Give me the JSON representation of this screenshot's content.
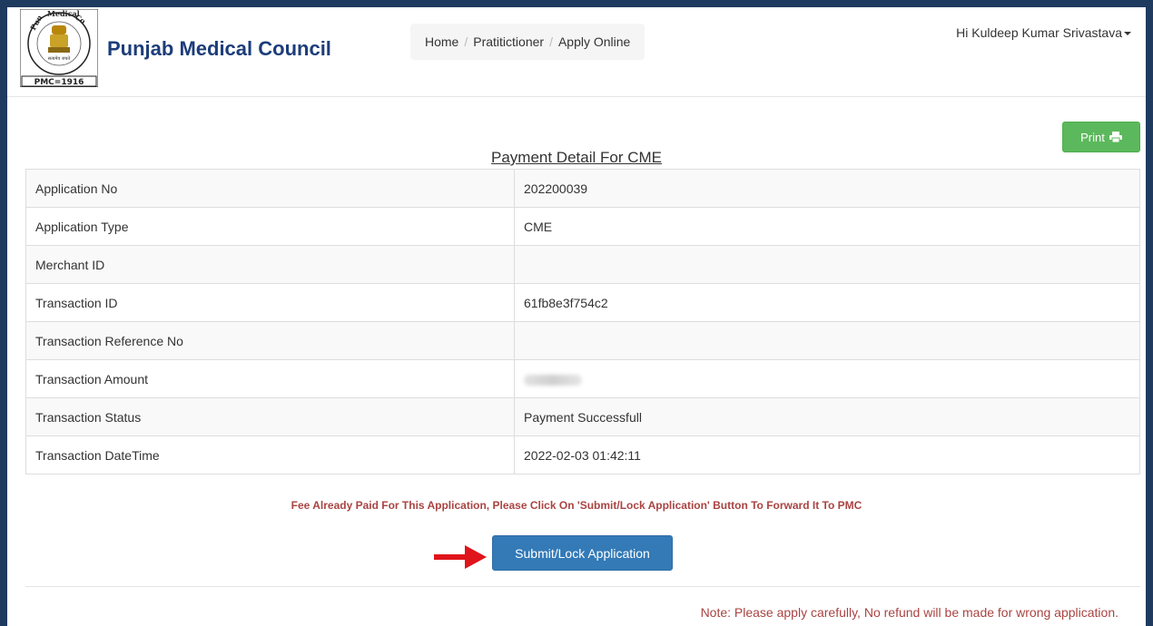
{
  "header": {
    "brand": "Punjab Medical Council",
    "logo_text": "PMC=1916",
    "breadcrumb": [
      "Home",
      "Pratitictioner",
      "Apply Online"
    ],
    "user_greeting": "Hi Kuldeep Kumar Srivastava"
  },
  "print_label": "Print",
  "page_title": "Payment Detail For CME",
  "details": [
    {
      "label": "Application No",
      "value": "202200039"
    },
    {
      "label": "Application Type",
      "value": "CME"
    },
    {
      "label": "Merchant ID",
      "value": ""
    },
    {
      "label": "Transaction ID",
      "value": "61fb8e3f754c2"
    },
    {
      "label": "Transaction Reference No",
      "value": ""
    },
    {
      "label": "Transaction Amount",
      "value": ""
    },
    {
      "label": "Transaction Status",
      "value": "Payment Successfull"
    },
    {
      "label": "Transaction DateTime",
      "value": "2022-02-03 01:42:11"
    }
  ],
  "notice": "Fee Already Paid For This Application, Please Click On 'Submit/Lock Application' Button To Forward It To PMC",
  "submit_label": "Submit/Lock Application",
  "note": "Note: Please apply carefully, No refund will be made for wrong application.",
  "colors": {
    "brand": "#1c3d7a",
    "primary": "#337ab7",
    "success": "#5cb85c",
    "danger": "#a94442",
    "arrow": "#e0141b"
  }
}
